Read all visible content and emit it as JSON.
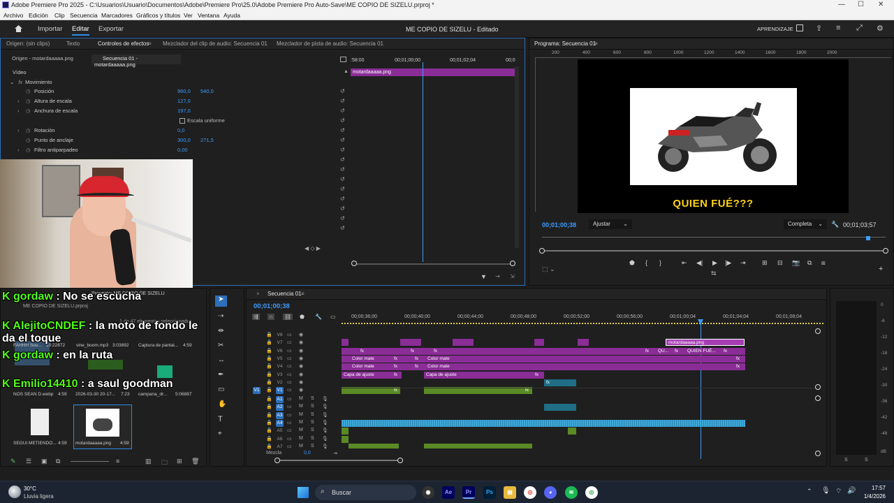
{
  "window": {
    "title": "Adobe Premiere Pro 2025 - C:\\Usuarios\\Usuario\\Documentos\\Adobe\\Premiere Pro\\25.0\\Adobe Premiere Pro Auto-Save\\ME COPIO DE SIZELU.prproj *",
    "controls": [
      "—",
      "☐",
      "✕"
    ]
  },
  "menu": [
    "Archivo",
    "Edición",
    "Clip",
    "Secuencia",
    "Marcadores",
    "Gráficos y títulos",
    "Ver",
    "Ventana",
    "Ayuda"
  ],
  "header": {
    "nav": [
      "Importar",
      "Editar",
      "Exportar"
    ],
    "project_title": "ME COPIO DE SIZELU - Editado",
    "learn": "APRENDIZAJE"
  },
  "effects_panel": {
    "tabs": [
      "Origen: (sin clips)",
      "Texto",
      "Controles de efectos",
      "Mezclador del clip de audio: Secuencia 01",
      "Mezclador de pista de audio: Secuencia 01"
    ],
    "subtabs": [
      "Origen - motardaaaaa.png",
      "Secuencia 01 - motardaaaaa.png"
    ],
    "section": "Vídeo",
    "group": "Movimiento",
    "props": [
      {
        "name": "Posición",
        "v1": "960,0",
        "v2": "540,0"
      },
      {
        "name": "Altura de escala",
        "v1": "127,0",
        "v2": ""
      },
      {
        "name": "Anchura de escala",
        "v1": "197,0",
        "v2": ""
      },
      {
        "name": "Escala uniforme",
        "v1": "",
        "v2": ""
      },
      {
        "name": "Rotación",
        "v1": "0,0",
        "v2": ""
      },
      {
        "name": "Punto de anclaje",
        "v1": "300,0",
        "v2": "271,5"
      },
      {
        "name": "Filtro antiparpadeo",
        "v1": "0,00",
        "v2": ""
      }
    ],
    "mini_timecodes": [
      ":58:00",
      "00;01;00;00",
      "00;01;02;04",
      "00;0"
    ],
    "clip_label": "motardaaaaa.png"
  },
  "program": {
    "tab": "Programa: Secuencia 01",
    "ruler": [
      "200",
      "400",
      "600",
      "800",
      "1000",
      "1200",
      "1400",
      "1600",
      "1800",
      "2000"
    ],
    "caption": "QUIEN FUÉ???",
    "timecode": "00;01;00;38",
    "fit": "Ajustar",
    "quality": "Completa",
    "duration": "00;01;03;57"
  },
  "project_panel": {
    "title": "Proyecto: ME COPIO DE SIZELU",
    "file": "ME COPIO DE SIZELU.prproj",
    "selected": "1 de 47 elementos seleccionados",
    "items": [
      {
        "name": "FAHHH Sou...",
        "dur": "10:22872"
      },
      {
        "name": "vine_boom.mp3",
        "dur": "3:03892"
      },
      {
        "name": "Captura de pantal...",
        "dur": "4:59"
      },
      {
        "name": "NOS SEAN D.webp",
        "dur": "4:59"
      },
      {
        "name": "2026-03-30 20-17...",
        "dur": "7:23"
      },
      {
        "name": "campana_dr...",
        "dur": "5:06887"
      },
      {
        "name": "SEGUI METIENDO...",
        "dur": "4:59"
      },
      {
        "name": "motardaaaaa.png",
        "dur": "4:59"
      }
    ]
  },
  "chat": [
    {
      "user": "gordaw",
      "msg": "No se escucha"
    },
    {
      "user": "AlejitoCNDEF",
      "msg": "la moto de fondo le da el toque"
    },
    {
      "user": "gordaw",
      "msg": "en la ruta"
    },
    {
      "user": "Emilio14410",
      "msg": "a saul goodman"
    }
  ],
  "timeline": {
    "tab": "Secuencia 01",
    "timecode": "00;01;00;38",
    "ruler": [
      "00;00;36;00",
      "00;00;40;00",
      "00;00;44;00",
      "00;00;48;00",
      "00;00;52;00",
      "00;00;56;00",
      "00;01;00;04",
      "00;01;04;04",
      "00;01;08;04"
    ],
    "video_tracks": [
      "V8",
      "V7",
      "V6",
      "V5",
      "V4",
      "V3",
      "V2",
      "V1"
    ],
    "audio_tracks": [
      "A1",
      "A2",
      "A3",
      "A4",
      "A5",
      "A6",
      "A7"
    ],
    "mix_label": "Mezcla",
    "mix_value": "0,0",
    "clip_labels": {
      "fx": "fx",
      "color_mate": "Color mate",
      "capa": "Capa de ajuste",
      "qu": "QU...",
      "quien": "QUIEN FUÉ...",
      "motard": "motardaaaaa.png"
    }
  },
  "meter": {
    "labels": [
      "0",
      "-6",
      "-12",
      "-18",
      "-24",
      "-30",
      "-36",
      "-42",
      "-48"
    ],
    "unit": "dB",
    "s": "S"
  },
  "taskbar": {
    "temp": "30°C",
    "weather": "Lluvia ligera",
    "search": "Buscar",
    "time": "17:57",
    "date": "1/4/2026"
  }
}
